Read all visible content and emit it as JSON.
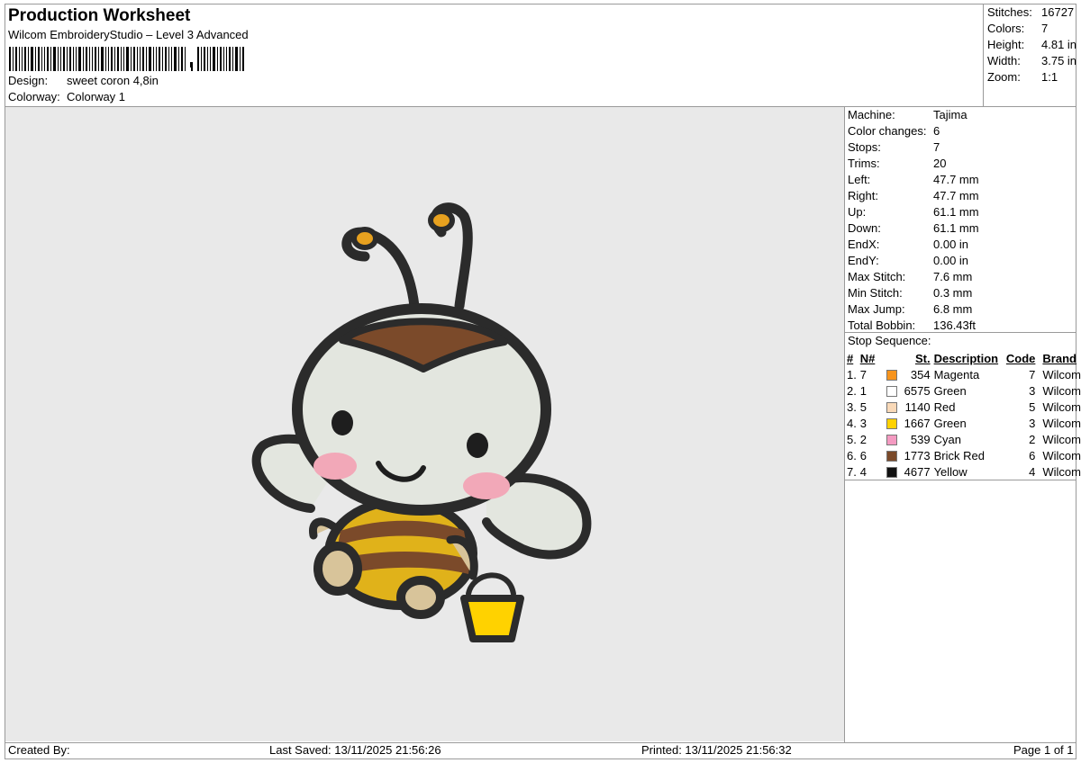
{
  "header": {
    "title": "Production Worksheet",
    "software": "Wilcom EmbroideryStudio – Level 3 Advanced",
    "design_label": "Design:",
    "design_value": "sweet coron 4,8in",
    "colorway_label": "Colorway:",
    "colorway_value": "Colorway 1"
  },
  "stats": [
    {
      "label": "Stitches:",
      "value": "16727"
    },
    {
      "label": "Colors:",
      "value": "7"
    },
    {
      "label": "Height:",
      "value": "4.81 in"
    },
    {
      "label": "Width:",
      "value": "3.75 in"
    },
    {
      "label": "Zoom:",
      "value": "1:1"
    }
  ],
  "machine_info": [
    {
      "label": "Machine:",
      "value": "Tajima"
    },
    {
      "label": "Color changes:",
      "value": "6"
    },
    {
      "label": "Stops:",
      "value": "7"
    },
    {
      "label": "Trims:",
      "value": "20"
    },
    {
      "label": "Left:",
      "value": "47.7 mm"
    },
    {
      "label": "Right:",
      "value": "47.7 mm"
    },
    {
      "label": "Up:",
      "value": "61.1 mm"
    },
    {
      "label": "Down:",
      "value": "61.1 mm"
    },
    {
      "label": "EndX:",
      "value": "0.00 in"
    },
    {
      "label": "EndY:",
      "value": "0.00 in"
    },
    {
      "label": "Max Stitch:",
      "value": "7.6 mm"
    },
    {
      "label": "Min Stitch:",
      "value": "0.3 mm"
    },
    {
      "label": "Max Jump:",
      "value": "6.8 mm"
    },
    {
      "label": "Total Bobbin:",
      "value": "136.43ft"
    }
  ],
  "stop_sequence": {
    "title": "Stop Sequence:",
    "headers": [
      "#",
      "N#",
      "St.",
      "Description",
      "Code",
      "Brand"
    ],
    "rows": [
      {
        "idx": "1.",
        "n": "7",
        "color": "#f7941d",
        "st": "354",
        "desc": "Magenta",
        "code": "7",
        "brand": "Wilcom"
      },
      {
        "idx": "2.",
        "n": "1",
        "color": "#ffffff",
        "st": "6575",
        "desc": "Green",
        "code": "3",
        "brand": "Wilcom"
      },
      {
        "idx": "3.",
        "n": "5",
        "color": "#f9d9b8",
        "st": "1140",
        "desc": "Red",
        "code": "5",
        "brand": "Wilcom"
      },
      {
        "idx": "4.",
        "n": "3",
        "color": "#ffd200",
        "st": "1667",
        "desc": "Green",
        "code": "3",
        "brand": "Wilcom"
      },
      {
        "idx": "5.",
        "n": "2",
        "color": "#f49ac1",
        "st": "539",
        "desc": "Cyan",
        "code": "2",
        "brand": "Wilcom"
      },
      {
        "idx": "6.",
        "n": "6",
        "color": "#7b4a2a",
        "st": "1773",
        "desc": "Brick Red",
        "code": "6",
        "brand": "Wilcom"
      },
      {
        "idx": "7.",
        "n": "4",
        "color": "#111111",
        "st": "4677",
        "desc": "Yellow",
        "code": "4",
        "brand": "Wilcom"
      }
    ]
  },
  "footer": {
    "created_by": "Created By:",
    "last_saved": "Last Saved: 13/11/2025 21:56:26",
    "printed": "Printed: 13/11/2025 21:56:32",
    "page": "Page 1 of 1"
  },
  "design_preview": {
    "subject": "bee-embroidery"
  }
}
